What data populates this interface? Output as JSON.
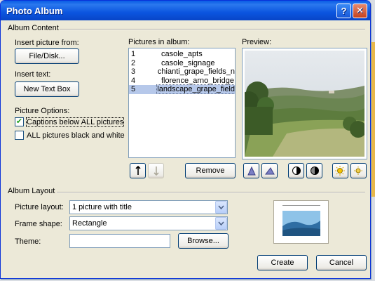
{
  "window": {
    "title": "Photo Album"
  },
  "titlebar": {
    "help_glyph": "?",
    "close_glyph": "✕"
  },
  "album_content": {
    "group_label": "Album Content",
    "insert_picture_label": "Insert picture from:",
    "file_disk_button": "File/Disk...",
    "insert_text_label": "Insert text:",
    "new_text_box_button": "New Text Box",
    "picture_options_label": "Picture Options:",
    "captions_checkbox": {
      "label": "Captions below ALL pictures",
      "checked": true
    },
    "bw_checkbox": {
      "label": "ALL pictures black and white",
      "checked": false
    }
  },
  "pictures": {
    "label": "Pictures in album:",
    "items": [
      {
        "num": "1",
        "name": "casole_apts",
        "selected": false
      },
      {
        "num": "2",
        "name": "casole_signage",
        "selected": false
      },
      {
        "num": "3",
        "name": "chianti_grape_fields_n",
        "selected": false
      },
      {
        "num": "4",
        "name": "florence_arno_bridge",
        "selected": false
      },
      {
        "num": "5",
        "name": "landscape_grape_field",
        "selected": true
      }
    ],
    "move_up_icon": "arrow-up-icon",
    "move_down_icon": "arrow-down-icon",
    "remove_button": "Remove"
  },
  "preview": {
    "label": "Preview:",
    "tools": [
      "rotate-left-icon",
      "rotate-right-icon",
      "contrast-up-icon",
      "contrast-down-icon",
      "brightness-up-icon",
      "brightness-down-icon"
    ]
  },
  "album_layout": {
    "group_label": "Album Layout",
    "picture_layout_label": "Picture layout:",
    "picture_layout_value": "1 picture with title",
    "frame_shape_label": "Frame shape:",
    "frame_shape_value": "Rectangle",
    "theme_label": "Theme:",
    "theme_value": "",
    "browse_button": "Browse..."
  },
  "actions": {
    "create_button": "Create",
    "cancel_button": "Cancel"
  },
  "colors": {
    "titlebar": "#0a5ce5",
    "dialog_bg": "#ece9d8",
    "selection": "#b6c8ea"
  }
}
